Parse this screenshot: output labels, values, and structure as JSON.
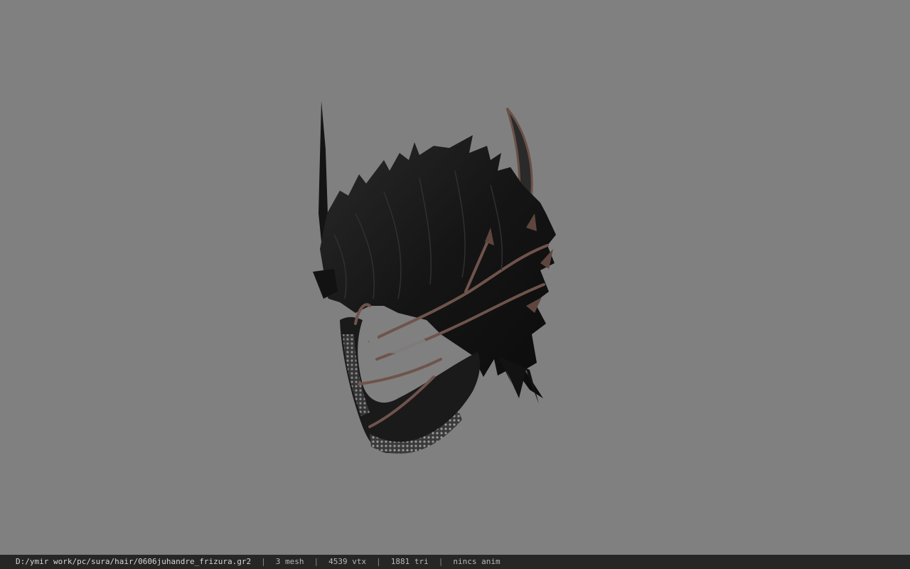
{
  "viewer": {
    "background_color": "#808080",
    "model": {
      "icon": "hair-mesh-model",
      "hair_color": "#151515",
      "ornament_color": "#7a5f55",
      "chain_color": "#9a9a9a"
    }
  },
  "status_bar": {
    "file_path": "D:/ymir work/pc/sura/hair/0606juhandre_frizura.gr2",
    "separator": "|",
    "mesh_count": "3 mesh",
    "vertex_count": "4539 vtx",
    "triangle_count": "1881 tri",
    "anim_status": "nincs anim"
  }
}
